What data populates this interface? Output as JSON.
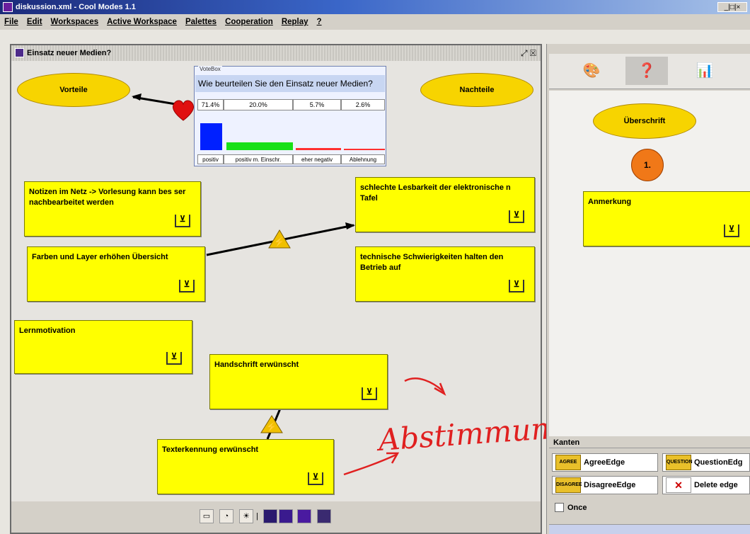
{
  "window": {
    "title": "diskussion.xml - Cool Modes 1.1",
    "controls": "_|□|×"
  },
  "menu": {
    "items": [
      "File",
      "Edit",
      "Workspaces",
      "Active Workspace",
      "Palettes",
      "Cooperation",
      "Replay",
      "?"
    ]
  },
  "workspace": {
    "title": "Einsatz neuer Medien?",
    "controls": "⤢ ☒"
  },
  "ellipses": {
    "vorteile": "Vorteile",
    "nachteile": "Nachteile"
  },
  "votebox": {
    "legend": "VoteBox",
    "question": "Wie beurteilen Sie den Einsatz neuer Medien?",
    "results": [
      {
        "percent": "71.4%",
        "value": 0.714,
        "category": "positiv",
        "color": "#0020ff"
      },
      {
        "percent": "20.0%",
        "value": 0.2,
        "category": "positiv m. Einschr.",
        "color": "#18e018"
      },
      {
        "percent": "5.7%",
        "value": 0.057,
        "category": "eher negativ",
        "color": "#ff3030"
      },
      {
        "percent": "2.6%",
        "value": 0.026,
        "category": "Ablehnung",
        "color": "#ff3030"
      }
    ]
  },
  "notes": {
    "notizen": "Notizen im Netz -> Vorlesung kann bes ser nachbearbeitet werden",
    "farben": "Farben und Layer erhöhen Übersicht",
    "lernmotivation": "Lernmotivation",
    "handschrift": "Handschrift erwünscht",
    "texterkennung": "Texterkennung erwünscht",
    "schlechte": "schlechte Lesbarkeit der elektronische n Tafel",
    "technische": "technische Schwierigkeiten halten den Betrieb auf"
  },
  "note_icon": "⊻",
  "annotation": {
    "text": "Abstimmung!",
    "color": "#e02020"
  },
  "palette": {
    "tabs": [
      "🎨",
      "❓",
      "📊"
    ],
    "heading_ellipse": "Überschrift",
    "number_circle": "1.",
    "note_label": "Anmerkung"
  },
  "edges": {
    "title": "Kanten",
    "agree": {
      "glyph": "AGREE",
      "label": "AgreeEdge"
    },
    "question": {
      "glyph": "QUESTION",
      "label": "QuestionEdg"
    },
    "disagree": {
      "glyph": "DISAGREE",
      "label": "DisagreeEdge"
    },
    "delete": {
      "glyph": "✕",
      "label": "Delete edge"
    },
    "once_label": "Once"
  },
  "bottom_toolbar": {
    "buttons": [
      "▭",
      "◔",
      "☀",
      "|"
    ]
  }
}
